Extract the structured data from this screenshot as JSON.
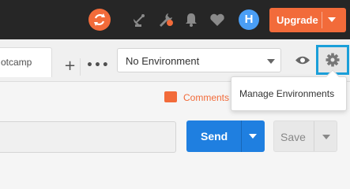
{
  "header": {
    "upgrade_label": "Upgrade",
    "avatar_initial": "H",
    "icons": [
      "sync-icon",
      "satellite-icon",
      "wrench-icon",
      "bell-icon",
      "heart-icon",
      "avatar"
    ],
    "colors": {
      "bar": "#262626",
      "accent": "#f26b3a",
      "avatar": "#4a9ef5"
    }
  },
  "tabs": {
    "active_tab_label": "otcamp",
    "add_label": "+",
    "more_label": "•••"
  },
  "environment": {
    "selected": "No Environment",
    "tooltip": "Manage Environments"
  },
  "comments": {
    "label": "Comments"
  },
  "request": {
    "url_value": "",
    "send_label": "Send",
    "save_label": "Save",
    "colors": {
      "send": "#1f7fe0",
      "highlight": "#1a9fd9"
    }
  }
}
